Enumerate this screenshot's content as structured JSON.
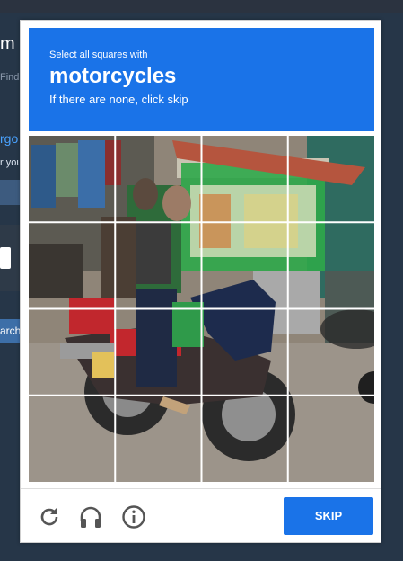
{
  "background_page": {
    "title_fragment": "m",
    "subtitle_fragment": "Find",
    "link_fragment": "rgo",
    "line_fragment": "r you",
    "search_fragment": "arch"
  },
  "captcha": {
    "instruction_small": "Select all squares with",
    "target_object": "motorcycles",
    "instruction_hint": "If there are none, click skip",
    "grid": {
      "rows": 4,
      "columns": 4,
      "selected_count": 0
    },
    "skip_label": "SKIP",
    "footer_icons": [
      "reload-icon",
      "audio-headphones-icon",
      "info-icon"
    ],
    "colors": {
      "brand_blue": "#1a73e8",
      "background": "#263648"
    }
  }
}
